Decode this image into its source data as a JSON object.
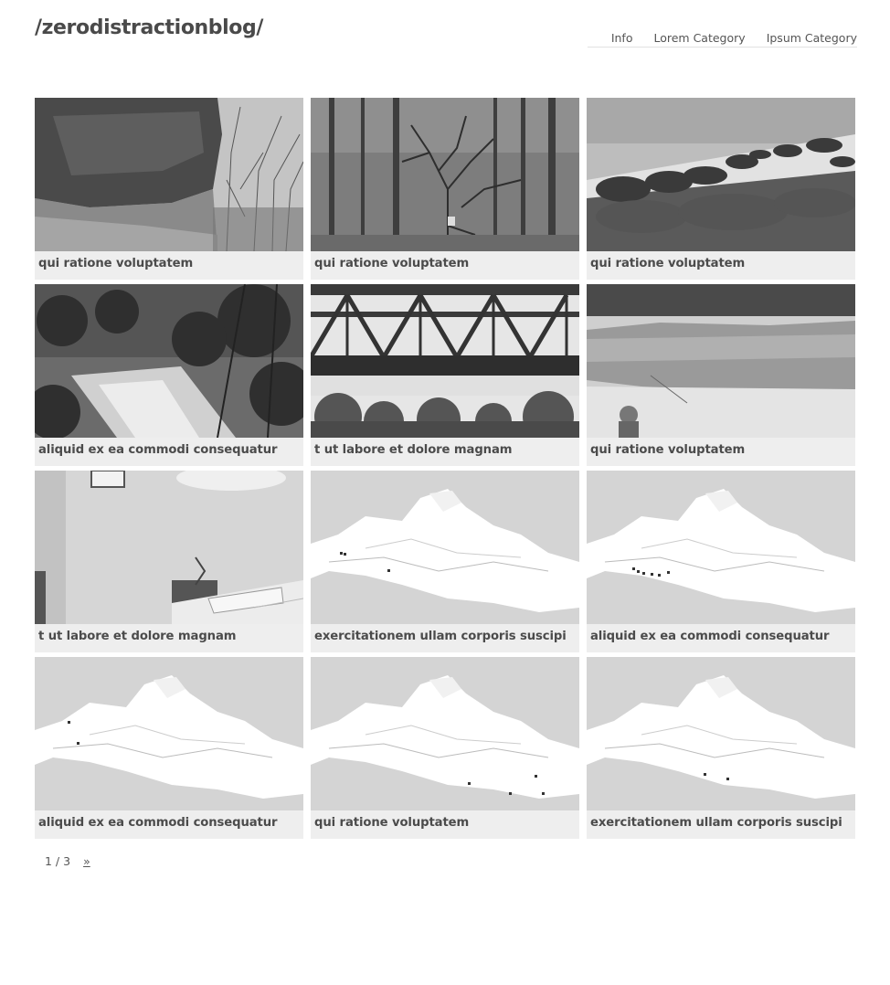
{
  "site": {
    "title": "/zerodistractionblog/"
  },
  "nav": {
    "items": [
      {
        "label": "Info"
      },
      {
        "label": "Lorem Category"
      },
      {
        "label": "Ipsum Category"
      }
    ]
  },
  "posts": [
    {
      "caption": "qui ratione voluptatem",
      "image": "rock-overhang-photo"
    },
    {
      "caption": "qui ratione voluptatem",
      "image": "forest-tree-photo"
    },
    {
      "caption": "qui ratione voluptatem",
      "image": "pine-cones-photo"
    },
    {
      "caption": "aliquid ex ea commodi consequatur",
      "image": "forest-stream-photo"
    },
    {
      "caption": "t ut labore et dolore magnam",
      "image": "steel-bridge-photo"
    },
    {
      "caption": "qui ratione voluptatem",
      "image": "rock-cliff-child-photo"
    },
    {
      "caption": "t ut labore et dolore magnam",
      "image": "bedroom-photo"
    },
    {
      "caption": "exercitationem ullam corporis suscipi",
      "image": "map-thumbnail"
    },
    {
      "caption": "aliquid ex ea commodi consequatur",
      "image": "map-thumbnail"
    },
    {
      "caption": "aliquid ex ea commodi consequatur",
      "image": "map-thumbnail"
    },
    {
      "caption": "qui ratione voluptatem",
      "image": "map-thumbnail"
    },
    {
      "caption": "exercitationem ullam corporis suscipi",
      "image": "map-thumbnail"
    }
  ],
  "pagination": {
    "current": "1 / 3",
    "next_label": "»"
  },
  "colors": {
    "text": "#555555",
    "caption_bg": "#eeeeee"
  }
}
